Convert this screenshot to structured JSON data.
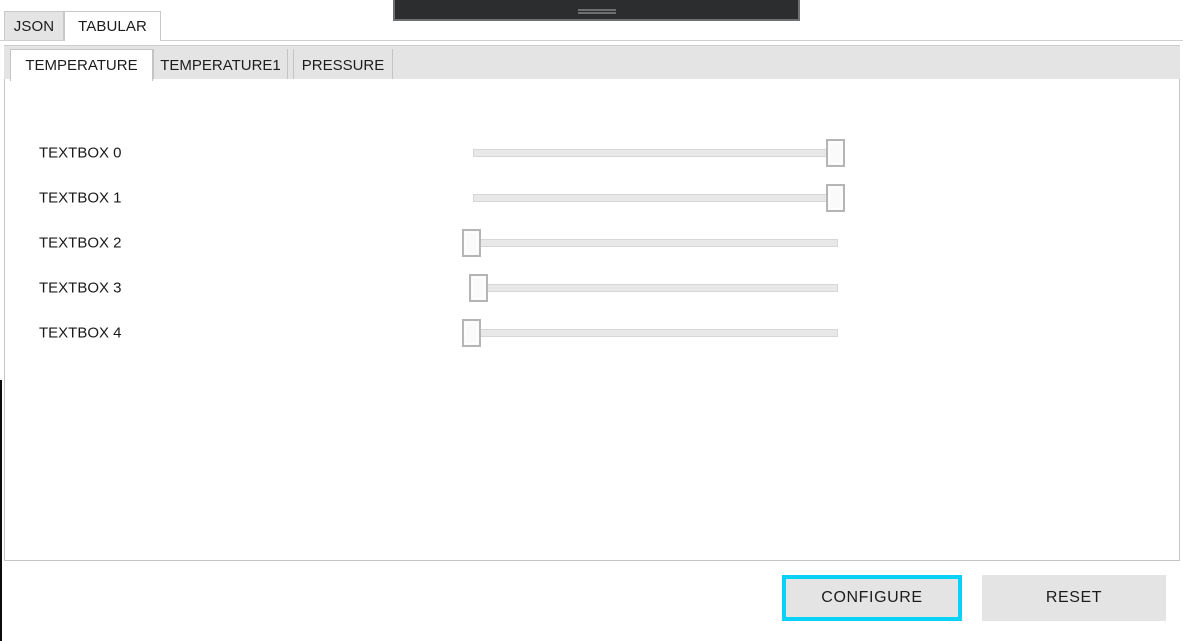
{
  "outer_tabs": [
    {
      "label": "JSON",
      "active": false
    },
    {
      "label": "TABULAR",
      "active": true
    }
  ],
  "inner_tabs": [
    {
      "label": "TEMPERATURE",
      "active": true
    },
    {
      "label": "TEMPERATURE1",
      "active": false
    },
    {
      "label": "PRESSURE",
      "active": false
    }
  ],
  "slider_rows": [
    {
      "label": "TEXTBOX 0",
      "value": 100
    },
    {
      "label": "TEXTBOX 1",
      "value": 100
    },
    {
      "label": "TEXTBOX 2",
      "value": 0
    },
    {
      "label": "TEXTBOX 3",
      "value": 2
    },
    {
      "label": "TEXTBOX 4",
      "value": 0
    }
  ],
  "buttons": {
    "configure_label": "CONFIGURE",
    "reset_label": "RESET"
  },
  "drawer": {
    "handle_icon": "drag-handle-icon"
  },
  "colors": {
    "focus_outline": "#0ad2f7",
    "tab_inactive_bg": "#e4e4e4",
    "tab_active_bg": "#ffffff",
    "button_bg": "#e4e4e4",
    "drawer_bg": "#2c2d2f"
  }
}
